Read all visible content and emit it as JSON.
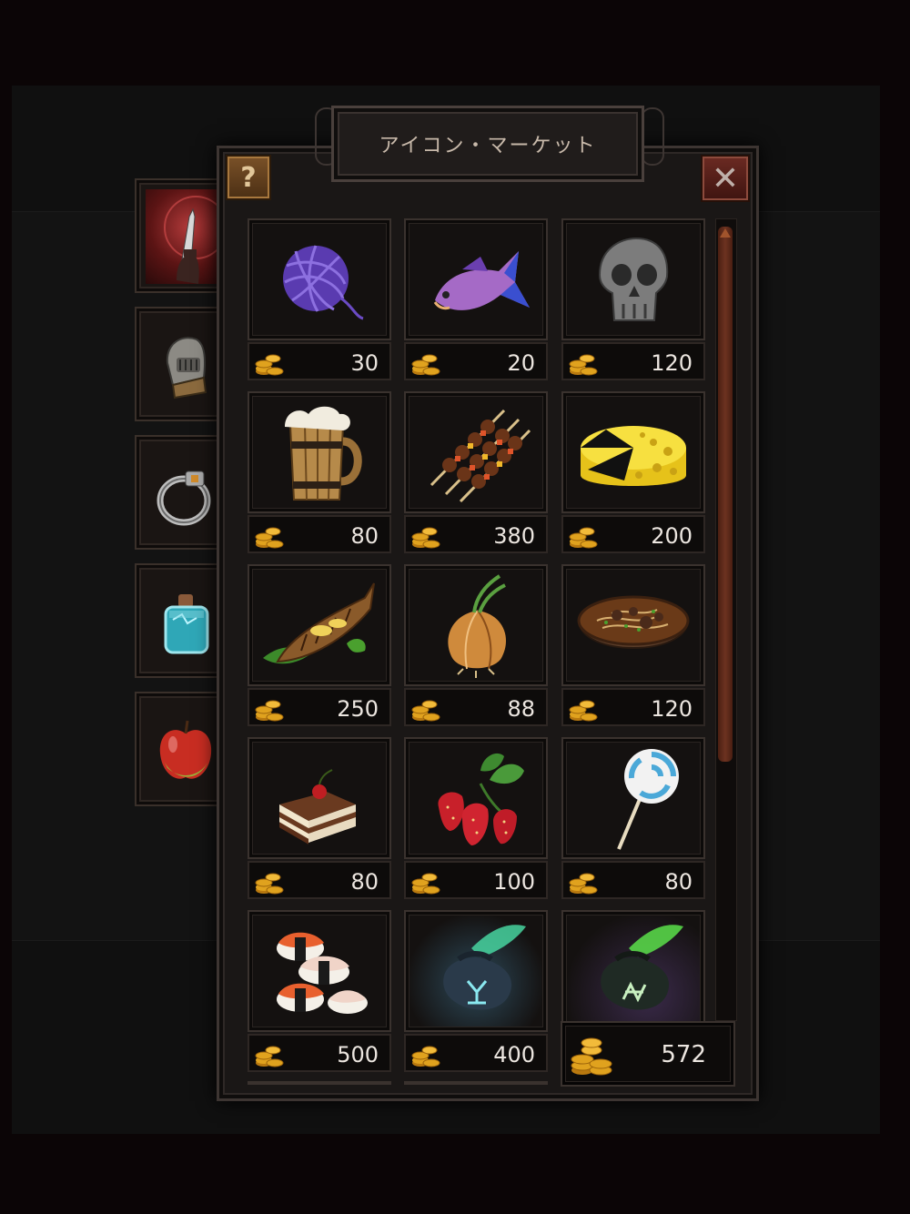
{
  "header": {
    "title": "アイコン・マーケット",
    "help_label": "?",
    "close_label": "✕"
  },
  "side_tabs": [
    {
      "name": "weapon",
      "icon": "dagger-hand-icon",
      "active": true
    },
    {
      "name": "armor",
      "icon": "helmet-icon",
      "active": false
    },
    {
      "name": "accessory",
      "icon": "ring-icon",
      "active": false
    },
    {
      "name": "potion",
      "icon": "potion-bottle-icon",
      "active": false
    },
    {
      "name": "food",
      "icon": "apple-icon",
      "active": false
    }
  ],
  "items": [
    {
      "name": "yarn-ball",
      "icon": "yarn-ball-icon",
      "price": "30"
    },
    {
      "name": "fish",
      "icon": "fish-icon",
      "price": "20"
    },
    {
      "name": "skull-sign",
      "icon": "skull-icon",
      "price": "120"
    },
    {
      "name": "beer-mug",
      "icon": "beer-mug-icon",
      "price": "80"
    },
    {
      "name": "kebab",
      "icon": "kebab-icon",
      "price": "380"
    },
    {
      "name": "cheese",
      "icon": "cheese-icon",
      "price": "200"
    },
    {
      "name": "grilled-fish",
      "icon": "grilled-fish-icon",
      "price": "250"
    },
    {
      "name": "onion",
      "icon": "onion-icon",
      "price": "88"
    },
    {
      "name": "noodle-soup",
      "icon": "soup-bowl-icon",
      "price": "120"
    },
    {
      "name": "cake",
      "icon": "cake-icon",
      "price": "80"
    },
    {
      "name": "strawberries",
      "icon": "strawberry-icon",
      "price": "100"
    },
    {
      "name": "lollipop",
      "icon": "lollipop-icon",
      "price": "80"
    },
    {
      "name": "sushi",
      "icon": "sushi-icon",
      "price": "500"
    },
    {
      "name": "magic-pouch-blue",
      "icon": "rune-pouch-icon",
      "price": "400"
    },
    {
      "name": "magic-pouch-green",
      "icon": "rune-pouch-icon",
      "price": ""
    }
  ],
  "wallet": {
    "icon": "gold-coins-icon",
    "amount": "572"
  },
  "colors": {
    "gold": "#e0a21e",
    "frame": "#3a322e",
    "accent_red": "#8d2a22"
  }
}
